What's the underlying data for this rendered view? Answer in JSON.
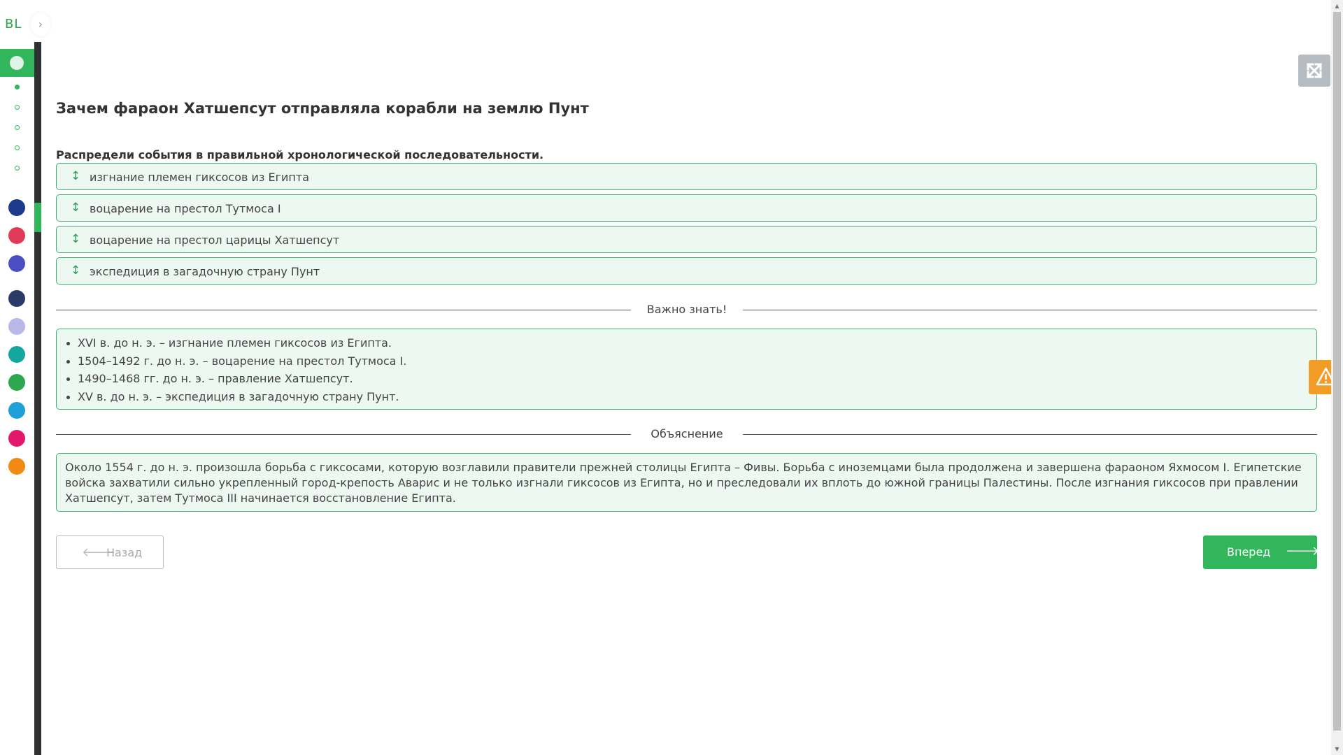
{
  "sidebar": {
    "logo": "BL",
    "chevron": "›",
    "app_icons": [
      {
        "name": "bilimland-icon",
        "color": "#1e3a8a"
      },
      {
        "name": "bilimshop-icon",
        "color": "#e03a5a"
      },
      {
        "name": "bilimclass-icon",
        "color": "#4b4fc4"
      },
      {
        "name": "smart-nation-icon",
        "color": "#2b3a67"
      },
      {
        "name": "keyboard-icon",
        "color": "#b9b6e8"
      },
      {
        "name": "bilim-media-icon",
        "color": "#14a7a0"
      },
      {
        "name": "bilimland-green-icon",
        "color": "#2ea84f"
      },
      {
        "name": "test-icon",
        "color": "#1ea0d8"
      },
      {
        "name": "itwiz-icon",
        "color": "#e3176b"
      },
      {
        "name": "orange-app-icon",
        "color": "#f08a12"
      }
    ]
  },
  "main": {
    "title": "Зачем фараон Хатшепсут отправляла корабли на землю Пунт",
    "task_label": "Распредели события в правильной хронологической последовательности.",
    "sort_items": [
      "изгнание племен гиксосов из Египта",
      "воцарение на престол Тутмоса I",
      "воцарение на престол царицы Хатшепсут",
      "экспедиция в загадочную страну Пунт"
    ],
    "important_label": "Важно знать!",
    "facts": [
      "XVI в. до н. э. – изгнание племен гиксосов из Египта.",
      "1504–1492 г. до н. э. – воцарение на престол Тутмоса I.",
      "1490–1468 гг. до н. э. – правление Хатшепсут.",
      "XV в. до н. э. – экспедиция в загадочную страну Пунт."
    ],
    "explanation_label": "Объяснение",
    "explanation": "Около 1554 г. до н. э. произошла борьба с гиксосами, которую возглавили правители прежней столицы Египта – Фивы. Борьба с иноземцами была продолжена и завершена фараоном Яхмосом I. Египетские войска захватили сильно укрепленный город-крепость Аварис и не только изгнали гиксосов из Египта, но и преследовали их вплоть до южной границы Палестины. После изгнания гиксосов при правлении Хатшепсут, затем Тутмоса III начинается восстановление Египта.",
    "back_label": "Назад",
    "next_label": "Вперед"
  },
  "colors": {
    "accent": "#32b65c",
    "item_bg": "#eef8f2",
    "warning": "#f39c25"
  }
}
